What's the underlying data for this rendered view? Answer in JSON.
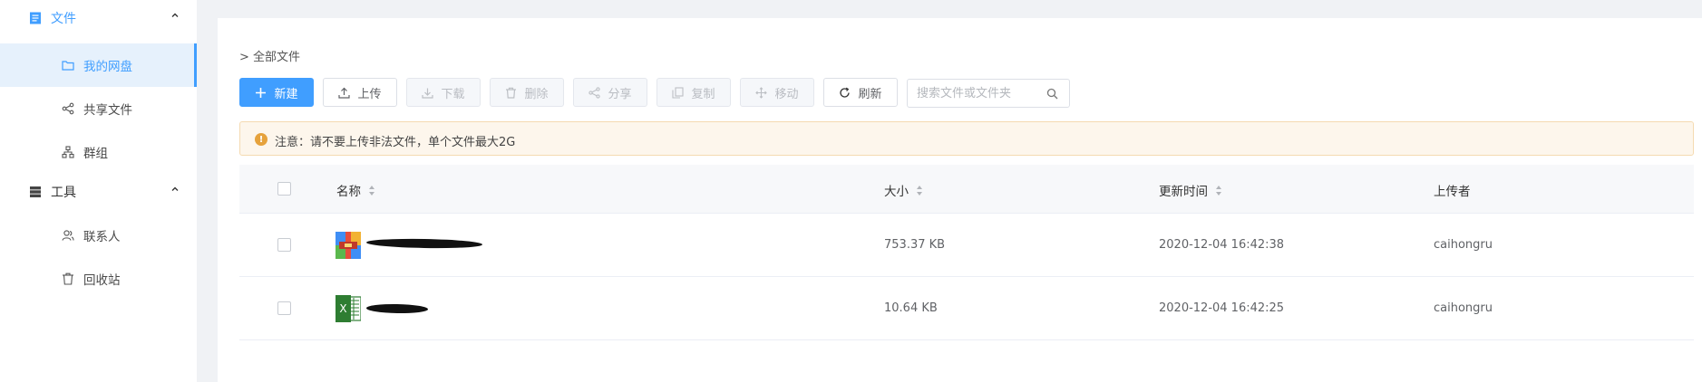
{
  "sidebar": {
    "files_group": {
      "label": "文件"
    },
    "items": [
      {
        "label": "我的网盘"
      },
      {
        "label": "共享文件"
      },
      {
        "label": "群组"
      }
    ],
    "tools_group": {
      "label": "工具"
    },
    "tool_items": [
      {
        "label": "联系人"
      },
      {
        "label": "回收站"
      }
    ]
  },
  "breadcrumb": "> 全部文件",
  "toolbar": {
    "new_label": "新建",
    "upload_label": "上传",
    "download_label": "下载",
    "delete_label": "删除",
    "share_label": "分享",
    "copy_label": "复制",
    "move_label": "移动",
    "refresh_label": "刷新"
  },
  "search": {
    "placeholder": "搜索文件或文件夹"
  },
  "notice": {
    "text": "注意：请不要上传非法文件，单个文件最大2G"
  },
  "table": {
    "headers": {
      "name": "名称",
      "size": "大小",
      "updated": "更新时间",
      "uploader": "上传者"
    },
    "rows": [
      {
        "icon": "archive-file-icon",
        "size": "753.37 KB",
        "updated": "2020-12-04 16:42:38",
        "uploader": "caihongru"
      },
      {
        "icon": "excel-file-icon",
        "size": "10.64 KB",
        "updated": "2020-12-04 16:42:25",
        "uploader": "caihongru"
      }
    ]
  },
  "colors": {
    "accent": "#409eff",
    "sidebar_active_bg": "#e6f1fc",
    "notice_bg": "#fdf6ec",
    "warn": "#e6a23c"
  }
}
